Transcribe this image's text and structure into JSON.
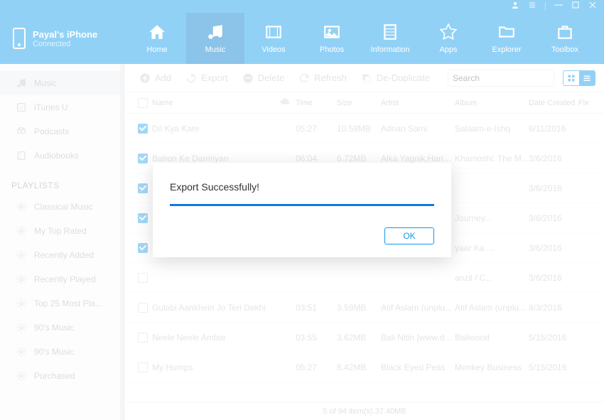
{
  "device": {
    "name": "Payal's iPhone",
    "status": "Connected"
  },
  "tabs": [
    {
      "label": "Home"
    },
    {
      "label": "Music"
    },
    {
      "label": "Videos"
    },
    {
      "label": "Photos"
    },
    {
      "label": "Information"
    },
    {
      "label": "Apps"
    },
    {
      "label": "Explorer"
    },
    {
      "label": "Toolbox"
    }
  ],
  "sidebar": {
    "items": [
      {
        "label": "Music"
      },
      {
        "label": "iTunes U"
      },
      {
        "label": "Podcasts"
      },
      {
        "label": "Audiobooks"
      }
    ],
    "playlistHeader": "PLAYLISTS",
    "playlists": [
      {
        "label": "Classical Music"
      },
      {
        "label": "My Top Rated"
      },
      {
        "label": "Recently Added"
      },
      {
        "label": "Recently Played"
      },
      {
        "label": "Top 25 Most Pla..."
      },
      {
        "label": "90's Music"
      },
      {
        "label": "90's Music"
      },
      {
        "label": "Purchased"
      }
    ]
  },
  "toolbar": {
    "add": "Add",
    "export": "Export",
    "delete": "Delete",
    "refresh": "Refresh",
    "dedup": "De-Duplicate",
    "searchPlaceholder": "Search"
  },
  "columns": {
    "name": "Name",
    "time": "Time",
    "size": "Size",
    "artist": "Artist",
    "album": "Album",
    "date": "Date Created",
    "fix": "Fix"
  },
  "rows": [
    {
      "checked": true,
      "name": "Dil Kya Kare",
      "time": "05:27",
      "size": "10.59MB",
      "artist": "Adnan Sami",
      "album": "Salaam-e-Ishq",
      "date": "6/11/2016"
    },
    {
      "checked": true,
      "name": "Bahon Ke Darmiyan",
      "time": "06:04",
      "size": "6.72MB",
      "artist": "Alka Yagnik,Haria...",
      "album": "Khamoshi: The M...",
      "date": "3/6/2016"
    },
    {
      "checked": true,
      "name": "",
      "time": "",
      "size": "",
      "artist": "",
      "album": "",
      "date": "3/6/2016"
    },
    {
      "checked": true,
      "name": "",
      "time": "",
      "size": "",
      "artist": "",
      "album": "Journey...",
      "date": "3/6/2016"
    },
    {
      "checked": true,
      "name": "",
      "time": "",
      "size": "",
      "artist": "",
      "album": "yaar Ka ...",
      "date": "3/6/2016"
    },
    {
      "checked": false,
      "name": "",
      "time": "",
      "size": "",
      "artist": "",
      "album": "anzil / C...",
      "date": "3/6/2016"
    },
    {
      "checked": false,
      "name": "Gulabi Aankhein Jo Teri Dekhi",
      "time": "03:51",
      "size": "3.59MB",
      "artist": "Atif Aslam (unplu...",
      "album": "Atif Aslam (unplu...",
      "date": "8/3/2016"
    },
    {
      "checked": false,
      "name": "Neele Neele Ambar",
      "time": "03:55",
      "size": "3.62MB",
      "artist": "Bali Nitin [www.d...",
      "album": "Baliwood",
      "date": "5/15/2016"
    },
    {
      "checked": false,
      "name": "My Humps",
      "time": "05:27",
      "size": "8.42MB",
      "artist": "Black Eyed Peas",
      "album": "Monkey Business",
      "date": "5/15/2016"
    }
  ],
  "status": "5 of 94 item(s),37.40MB",
  "dialog": {
    "title": "Export Successfully!",
    "ok": "OK"
  }
}
